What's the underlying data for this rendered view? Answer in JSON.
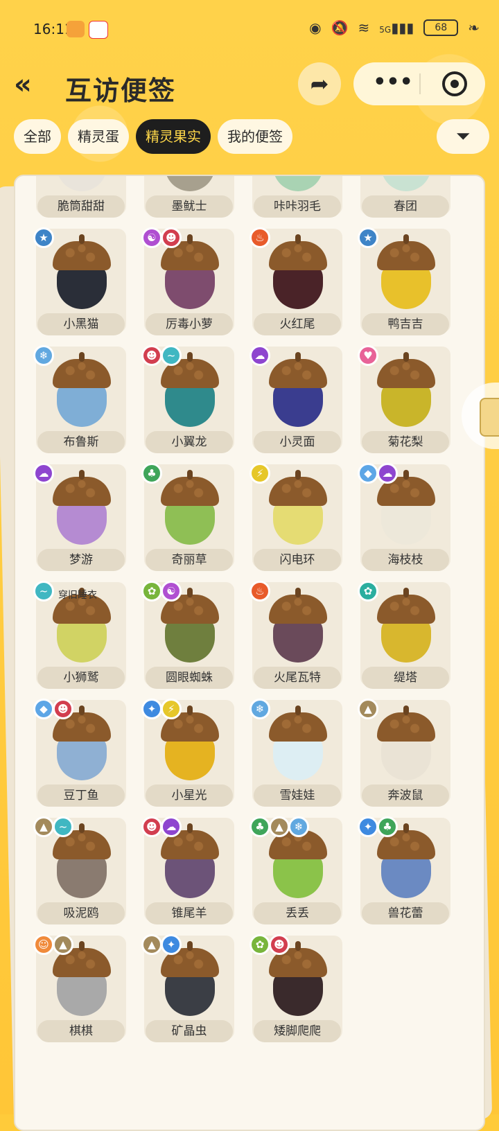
{
  "status_bar": {
    "time": "16:11",
    "battery": "68",
    "network": "5G"
  },
  "header": {
    "title": "互访便签",
    "back_icon": "chevron-double-left-icon",
    "share_icon": "share-icon",
    "more_icon": "more-dots-icon",
    "target_icon": "record-target-icon"
  },
  "tabs": [
    {
      "label": "全部",
      "active": false
    },
    {
      "label": "精灵蛋",
      "active": false
    },
    {
      "label": "精灵果实",
      "active": true
    },
    {
      "label": "我的便签",
      "active": false
    }
  ],
  "filter_icon": "filter-icon",
  "colors": {
    "accent": "#FFCB3A",
    "dark": "#1E1E1E",
    "card": "#FBF7EE"
  },
  "items": [
    {
      "name": "脆筒甜甜",
      "body": "#E9E4DB",
      "badges": []
    },
    {
      "name": "墨鱿士",
      "body": "#A7A08E",
      "badges": []
    },
    {
      "name": "咔咔羽毛",
      "body": "#A9D3B3",
      "badges": []
    },
    {
      "name": "春团",
      "body": "#C9E2D2",
      "badges": []
    },
    {
      "name": "小黑猫",
      "body": "#2A2E38",
      "badges": [
        {
          "color": "#3E84C7",
          "icon": "★"
        }
      ]
    },
    {
      "name": "厉毒小萝",
      "body": "#7E4C6E",
      "badges": [
        {
          "color": "#B04FD1",
          "icon": "☯"
        },
        {
          "color": "#D23E4F",
          "icon": "☻"
        }
      ]
    },
    {
      "name": "火红尾",
      "body": "#4A2328",
      "badges": [
        {
          "color": "#E85B2B",
          "icon": "♨"
        }
      ]
    },
    {
      "name": "鸭吉吉",
      "body": "#E8C12B",
      "badges": [
        {
          "color": "#3E84C7",
          "icon": "★"
        }
      ]
    },
    {
      "name": "布鲁斯",
      "body": "#7FAED6",
      "badges": [
        {
          "color": "#61A8E0",
          "icon": "❄"
        }
      ]
    },
    {
      "name": "小翼龙",
      "body": "#2F8A8C",
      "badges": [
        {
          "color": "#D23E4F",
          "icon": "☻"
        },
        {
          "color": "#40B7C2",
          "icon": "~"
        }
      ]
    },
    {
      "name": "小灵面",
      "body": "#3A3D8F",
      "badges": [
        {
          "color": "#8E45CF",
          "icon": "☁"
        }
      ]
    },
    {
      "name": "菊花梨",
      "body": "#C9B52A",
      "badges": [
        {
          "color": "#E86398",
          "icon": "♥"
        }
      ]
    },
    {
      "name": "梦游",
      "body": "#B58BD2",
      "badges": [
        {
          "color": "#8E45CF",
          "icon": "☁"
        }
      ]
    },
    {
      "name": "奇丽草",
      "body": "#8FBF55",
      "badges": [
        {
          "color": "#3FA55A",
          "icon": "♣"
        }
      ]
    },
    {
      "name": "闪电环",
      "body": "#E5DC73",
      "badges": [
        {
          "color": "#E6C72A",
          "icon": "⚡"
        }
      ]
    },
    {
      "name": "海枝枝",
      "body": "#EDE8DA",
      "badges": [
        {
          "color": "#5DA6E6",
          "icon": "◆"
        },
        {
          "color": "#8E45CF",
          "icon": "☁"
        }
      ]
    },
    {
      "name": "小狮鹫",
      "body": "#D1D364",
      "badges": [
        {
          "color": "#40B7C2",
          "icon": "~"
        }
      ]
    },
    {
      "name": "圆眼蜘蛛",
      "body": "#6F7F3E",
      "badges": [
        {
          "color": "#78B53C",
          "icon": "✿"
        },
        {
          "color": "#B04FD1",
          "icon": "☯"
        }
      ]
    },
    {
      "name": "火尾瓦特",
      "body": "#6A4A5A",
      "badges": [
        {
          "color": "#E85B2B",
          "icon": "♨"
        }
      ]
    },
    {
      "name": "缇塔",
      "body": "#D8B72E",
      "badges": [
        {
          "color": "#2BAE9F",
          "icon": "✿"
        }
      ]
    },
    {
      "name": "豆丁鱼",
      "body": "#8FB0D3",
      "badges": [
        {
          "color": "#5DA6E6",
          "icon": "◆"
        },
        {
          "color": "#D23E4F",
          "icon": "☻"
        }
      ]
    },
    {
      "name": "小星光",
      "body": "#E5B321",
      "badges": [
        {
          "color": "#3E8AE0",
          "icon": "✦"
        },
        {
          "color": "#E6C72A",
          "icon": "⚡"
        }
      ]
    },
    {
      "name": "雪娃娃",
      "body": "#DDEEF3",
      "badges": [
        {
          "color": "#61A8E0",
          "icon": "❄"
        }
      ]
    },
    {
      "name": "奔波鼠",
      "body": "#EAE3D5",
      "badges": [
        {
          "color": "#A38A5C",
          "icon": "▲"
        }
      ]
    },
    {
      "name": "吸泥鸥",
      "body": "#8A7B70",
      "badges": [
        {
          "color": "#A38A5C",
          "icon": "▲"
        },
        {
          "color": "#40B7C2",
          "icon": "~"
        }
      ]
    },
    {
      "name": "锥尾羊",
      "body": "#6C5378",
      "badges": [
        {
          "color": "#D23E4F",
          "icon": "☻"
        },
        {
          "color": "#8E45CF",
          "icon": "☁"
        }
      ]
    },
    {
      "name": "丢丢",
      "body": "#8BC34A",
      "badges": [
        {
          "color": "#3FA55A",
          "icon": "♣"
        },
        {
          "color": "#A38A5C",
          "icon": "▲"
        },
        {
          "color": "#61A8E0",
          "icon": "❄"
        }
      ]
    },
    {
      "name": "兽花蕾",
      "body": "#6B8AC2",
      "badges": [
        {
          "color": "#3E8AE0",
          "icon": "✦"
        },
        {
          "color": "#3FA55A",
          "icon": "♣"
        }
      ]
    },
    {
      "name": "棋棋",
      "body": "#A9A9A9",
      "badges": [
        {
          "color": "#F08A3A",
          "icon": "☺"
        },
        {
          "color": "#A38A5C",
          "icon": "▲"
        }
      ]
    },
    {
      "name": "矿晶虫",
      "body": "#3B3E45",
      "badges": [
        {
          "color": "#A38A5C",
          "icon": "▲"
        },
        {
          "color": "#3E8AE0",
          "icon": "✦"
        }
      ]
    },
    {
      "name": "矮脚爬爬",
      "body": "#3A2A2C",
      "badges": [
        {
          "color": "#78B53C",
          "icon": "✿"
        },
        {
          "color": "#D23E4F",
          "icon": "☻"
        }
      ]
    }
  ],
  "note": {
    "text": "穿旧睡衣"
  }
}
